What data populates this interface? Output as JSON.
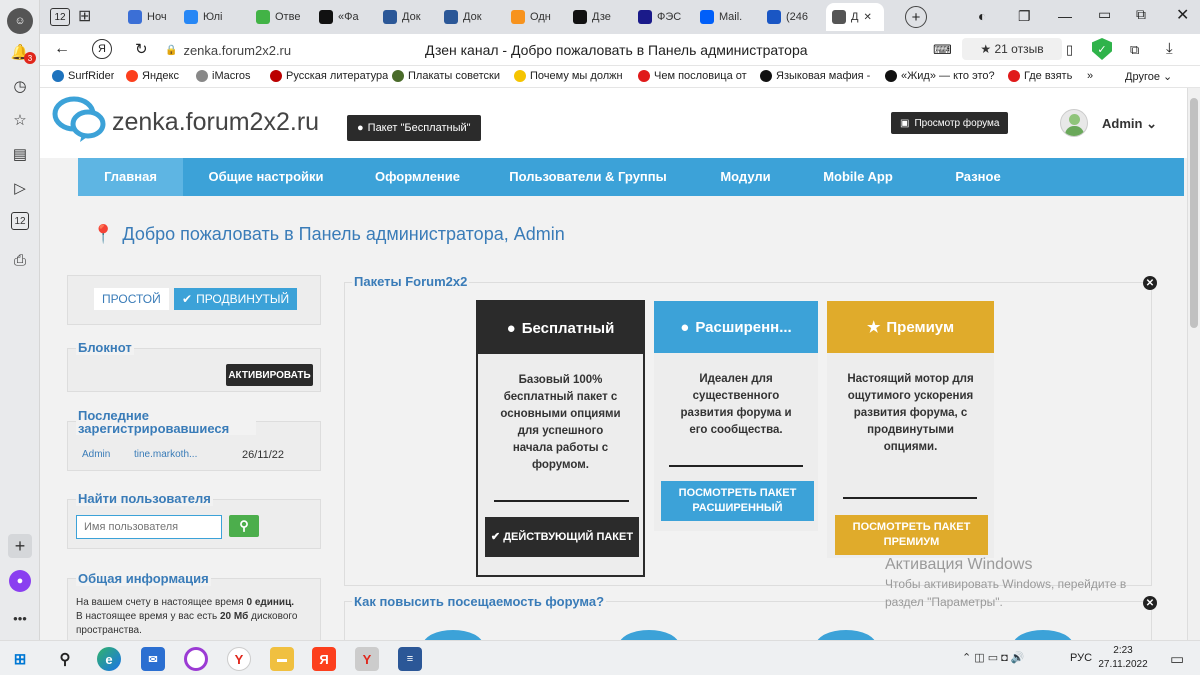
{
  "browser": {
    "tabs": [
      {
        "label": "Ноч",
        "icon": "N-icon",
        "color": "#3b6fd6"
      },
      {
        "label": "Юлі",
        "icon": "vk-icon",
        "color": "#2787f5"
      },
      {
        "label": "Отве",
        "icon": "answers-icon",
        "color": "#42b346"
      },
      {
        "label": "«Фа",
        "icon": "dzen-icon",
        "color": "#111"
      },
      {
        "label": "Док",
        "icon": "word-icon",
        "color": "#2b5797"
      },
      {
        "label": "Док",
        "icon": "word-icon",
        "color": "#2b5797"
      },
      {
        "label": "Одн",
        "icon": "ok-icon",
        "color": "#f7931e"
      },
      {
        "label": "Дзе",
        "icon": "dzen-icon",
        "color": "#111"
      },
      {
        "label": "ФЭС",
        "icon": "fp-icon",
        "color": "#1a1a8a"
      },
      {
        "label": "Mail.",
        "icon": "mail-icon",
        "color": "#005ff9"
      },
      {
        "label": "(246",
        "icon": "mail-envelope-icon",
        "color": "#1a56c4"
      },
      {
        "label": "Д",
        "icon": "chat-icon",
        "color": "#555"
      }
    ],
    "tab_counter": "12",
    "url": "zenka.forum2x2.ru",
    "page_title": "Дзен канал - Добро пожаловать в Панель администратора",
    "reviews": "★ 21 отзыв",
    "bookmarks": [
      {
        "label": "SurfRider",
        "color": "#1e73be"
      },
      {
        "label": "Яндекс",
        "color": "#fc3f1d"
      },
      {
        "label": "iMacros",
        "color": "#888"
      },
      {
        "label": "Русская литература",
        "color": "#b00"
      },
      {
        "label": "Плакаты советски",
        "color": "#4a6b2a"
      },
      {
        "label": "Почему мы должн",
        "color": "#f5c400"
      },
      {
        "label": "Чем пословица от",
        "color": "#e01a1a"
      },
      {
        "label": "Языковая мафия -",
        "color": "#111"
      },
      {
        "label": "«Жид» — кто это?",
        "color": "#111"
      },
      {
        "label": "Где взять",
        "color": "#e01a1a"
      }
    ],
    "bookmarks_more": "»",
    "bookmarks_other": "Другое"
  },
  "sidebar": {
    "notification_badge": "3",
    "counter": "12"
  },
  "site": {
    "logo_text": "zenka.forum2x2.ru",
    "package_badge": "Пакет \"Бесплатный\"",
    "view_forum": "Просмотр форума",
    "admin_name": "Admin",
    "nav": [
      "Главная",
      "Общие настройки",
      "Оформление",
      "Пользователи & Группы",
      "Модули",
      "Mobile App",
      "Разное"
    ],
    "welcome": "Добро пожаловать в Панель администратора, Admin"
  },
  "left": {
    "mode_simple": "ПРОСТОЙ",
    "mode_advanced": "ПРОДВИНУТЫЙ",
    "notepad_title": "Блокнот",
    "activate": "АКТИВИРОВАТЬ",
    "recent_title": "Последние зарегистрировавшиеся",
    "recent_row": {
      "user": "Admin",
      "email": "tine.markoth...",
      "date": "26/11/22"
    },
    "find_title": "Найти пользователя",
    "find_placeholder": "Имя пользователя",
    "general_title": "Общая информация",
    "general_line1_pre": "На вашем счету в настоящее время ",
    "general_line1_bold": "0 единиц.",
    "general_line2_pre": "В настоящее время у вас есть ",
    "general_line2_bold": "20 Мб",
    "general_line2_post": " дискового пространства."
  },
  "packages": {
    "title": "Пакеты Forum2x2",
    "items": [
      {
        "name": "Бесплатный",
        "desc": "Базовый 100% бесплатный пакет с основными опциями для успешного начала работы с форумом.",
        "button": "✔ ДЕЙСТВУЮЩИЙ ПАКЕТ",
        "color": "#2b2b2b"
      },
      {
        "name": "Расширенн...",
        "desc": "Идеален для существенного развития форума и его сообщества.",
        "button": "ПОСМОТРЕТЬ ПАКЕТ РАСШИРЕННЫЙ",
        "color": "#3ca2d8"
      },
      {
        "name": "Премиум",
        "desc": "Настоящий мотор для ощутимого ускорения развития форума, с продвинутыми опциями.",
        "button": "ПОСМОТРЕТЬ ПАКЕТ ПРЕМИУМ",
        "color": "#e0ab2b"
      }
    ]
  },
  "traffic": {
    "title": "Как повысить посещаемость форума?"
  },
  "watermark": {
    "line1": "Активация Windows",
    "line2": "Чтобы активировать Windows, перейдите в",
    "line3": "раздел \"Параметры\"."
  },
  "taskbar": {
    "lang": "РУС",
    "time": "2:23",
    "date": "27.11.2022"
  }
}
